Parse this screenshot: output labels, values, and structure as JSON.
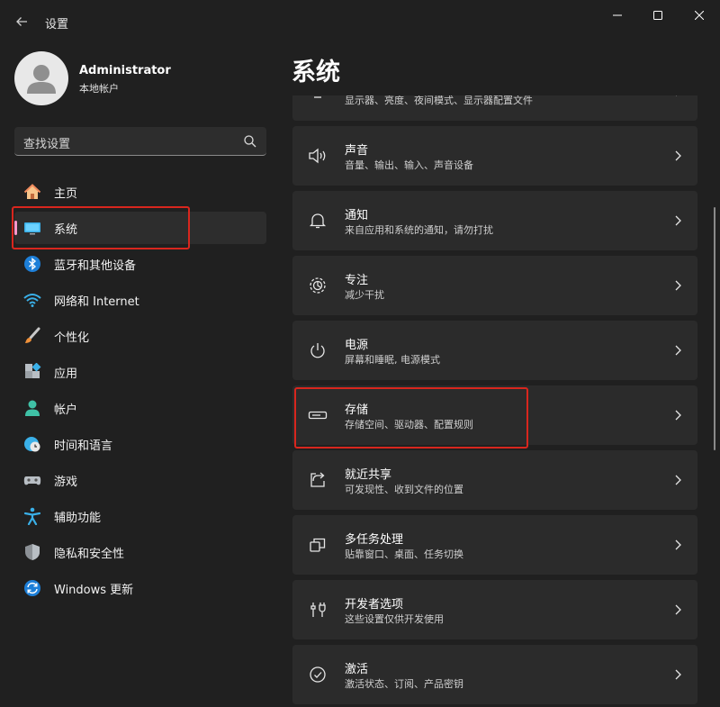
{
  "window": {
    "title": "设置",
    "back_icon": "back-arrow-icon",
    "controls": [
      "minimize-icon",
      "maximize-icon",
      "close-icon"
    ]
  },
  "profile": {
    "name": "Administrator",
    "account_type": "本地帐户"
  },
  "search": {
    "placeholder": "查找设置"
  },
  "sidebar": {
    "items": [
      {
        "label": "主页",
        "icon": "home-icon",
        "active": false
      },
      {
        "label": "系统",
        "icon": "monitor-icon",
        "active": true
      },
      {
        "label": "蓝牙和其他设备",
        "icon": "bluetooth-icon",
        "active": false
      },
      {
        "label": "网络和 Internet",
        "icon": "wifi-icon",
        "active": false
      },
      {
        "label": "个性化",
        "icon": "brush-icon",
        "active": false
      },
      {
        "label": "应用",
        "icon": "apps-icon",
        "active": false
      },
      {
        "label": "帐户",
        "icon": "account-icon",
        "active": false
      },
      {
        "label": "时间和语言",
        "icon": "clock-globe-icon",
        "active": false
      },
      {
        "label": "游戏",
        "icon": "gamepad-icon",
        "active": false
      },
      {
        "label": "辅助功能",
        "icon": "accessibility-icon",
        "active": false
      },
      {
        "label": "隐私和安全性",
        "icon": "shield-icon",
        "active": false
      },
      {
        "label": "Windows 更新",
        "icon": "update-icon",
        "active": false
      }
    ]
  },
  "main": {
    "title": "系统",
    "cards": [
      {
        "title": "",
        "subtitle": "显示器、亮度、夜间模式、显示器配置文件",
        "icon": "display-icon"
      },
      {
        "title": "声音",
        "subtitle": "音量、输出、输入、声音设备",
        "icon": "speaker-icon"
      },
      {
        "title": "通知",
        "subtitle": "来自应用和系统的通知，请勿打扰",
        "icon": "bell-icon"
      },
      {
        "title": "专注",
        "subtitle": "减少干扰",
        "icon": "focus-icon"
      },
      {
        "title": "电源",
        "subtitle": "屏幕和睡眠, 电源模式",
        "icon": "power-icon"
      },
      {
        "title": "存储",
        "subtitle": "存储空间、驱动器、配置规则",
        "icon": "storage-icon"
      },
      {
        "title": "就近共享",
        "subtitle": "可发现性、收到文件的位置",
        "icon": "share-icon"
      },
      {
        "title": "多任务处理",
        "subtitle": "贴靠窗口、桌面、任务切换",
        "icon": "multitask-icon"
      },
      {
        "title": "开发者选项",
        "subtitle": "这些设置仅供开发使用",
        "icon": "developer-icon"
      },
      {
        "title": "激活",
        "subtitle": "激活状态、订阅、产品密钥",
        "icon": "activation-icon"
      }
    ]
  },
  "colors": {
    "background": "#202020",
    "card": "#2b2b2b",
    "active_indicator": "#ff99cc",
    "highlight_annotation": "#d8261e"
  }
}
